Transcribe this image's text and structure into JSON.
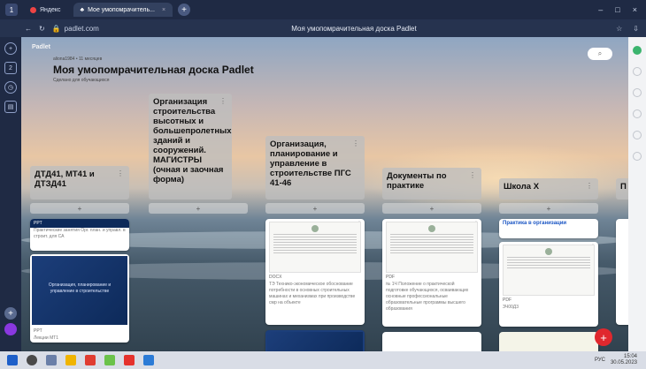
{
  "browser": {
    "tabs": [
      {
        "label": "Яндекс",
        "active": false
      },
      {
        "label": "Мое умопомрачитель...",
        "active": true
      }
    ],
    "url": "padlet.com",
    "page_title": "Моя умопомрачительная доска Padlet"
  },
  "board": {
    "logo": "Padlet",
    "author": "aliona1984 • 11 месяцев",
    "title": "Моя умопомрачительная доска Padlet",
    "subtitle": "Сделано для обучающихся",
    "add_symbol": "+"
  },
  "columns": [
    {
      "title": "ДТД41, МТ41 и ДТЗД41"
    },
    {
      "title": "Организация строительства высотных и большепролетных зданий и сооружений. МАГИСТРЫ (очная и заочная форма)"
    },
    {
      "title": "Организация, планирование и управление в строительстве ПГС 41-46"
    },
    {
      "title": "Документы по практике"
    },
    {
      "title": "Школа Х"
    },
    {
      "title": "П"
    }
  ],
  "cards": {
    "col1_top_tag": "PPT",
    "col1_top_desc": "Практические занятия Орг. план. и управл. в строит. для СА",
    "col1_slide_text": "Организация, планирование и управление в строительстве",
    "col1_bottom_tag": "PPT",
    "col1_bottom_desc": "Лекции МТ1",
    "col3_tag": "DOCX",
    "col3_desc": "ТЭ Технико-экономическое обоснование потребности в основных строительных машинах и механизмах при производстве смр на объекте",
    "col4_tag": "PDF",
    "col4_desc": "№ 1Ч Положение о практической подготовке обучающихся, осваивающих основные профессиональные образовательные программы высшего образования",
    "col5_link": "Практика в организации",
    "col5_tag": "PDF",
    "col5_desc": "ЗЧ00Д3"
  },
  "taskbar": {
    "time": "15:04",
    "date": "30.05.2023",
    "lang": "РУС"
  },
  "colors": {
    "accent_fab": "#e0282e",
    "browser_bg": "#1f2a44"
  }
}
